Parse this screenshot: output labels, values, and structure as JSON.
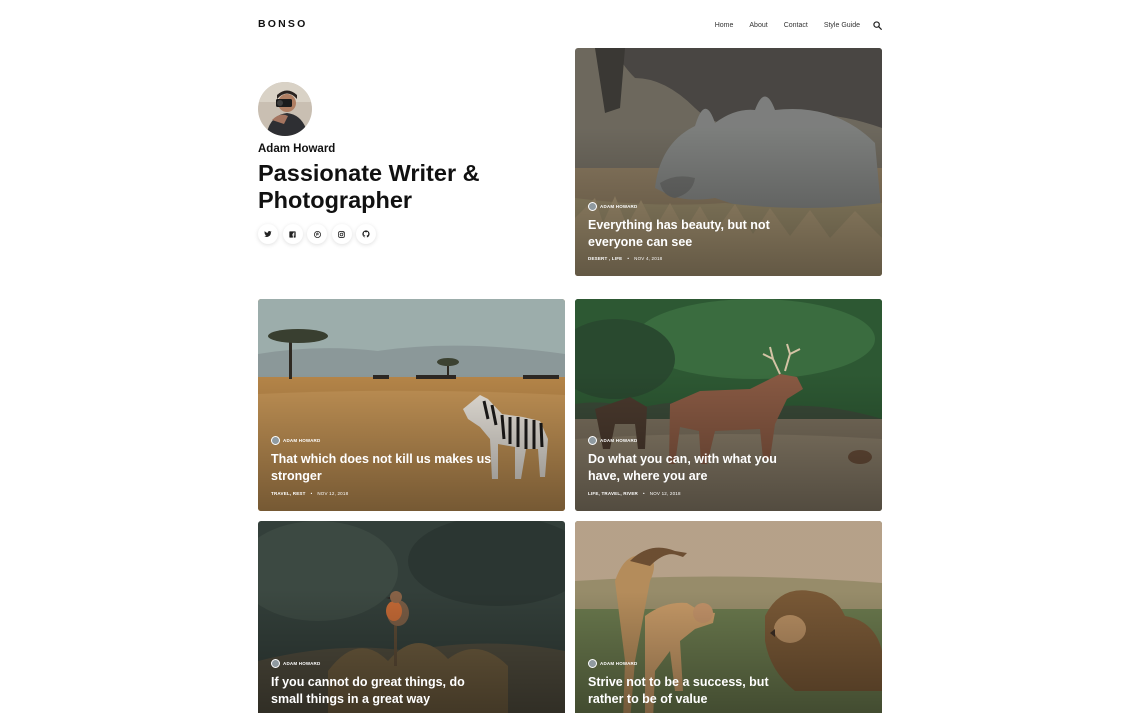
{
  "site": {
    "logo": "BONSO",
    "nav": [
      "Home",
      "About",
      "Contact",
      "Style Guide"
    ]
  },
  "profile": {
    "name": "Adam Howard",
    "headline_line1": "Passionate Writer &",
    "headline_line2": "Photographer",
    "socials": [
      "twitter-icon",
      "facebook-icon",
      "pinterest-icon",
      "instagram-icon",
      "github-icon"
    ]
  },
  "posts": [
    {
      "author": "ADAM HOWARD",
      "title_line1": "Everything has beauty, but not",
      "title_line2": "everyone can see",
      "categories": "DESERT , LIFE",
      "date": "NOV 4, 2018"
    },
    {
      "author": "ADAM HOWARD",
      "title_line1": "That which does not kill us makes us",
      "title_line2": "stronger",
      "categories": "TRAVEL, REST",
      "date": "NOV 12, 2018"
    },
    {
      "author": "ADAM HOWARD",
      "title_line1": "Do what you can, with what you",
      "title_line2": "have, where you are",
      "categories": "LIFE, TRAVEL, RIVER",
      "date": "NOV 12, 2018"
    },
    {
      "author": "ADAM HOWARD",
      "title_line1": "If you cannot do great things, do",
      "title_line2": "small things in a great way"
    },
    {
      "author": "ADAM HOWARD",
      "title_line1": "Strive not to be a success, but",
      "title_line2": "rather to be of value"
    }
  ],
  "colors": {
    "text": "#111111",
    "background": "#ffffff"
  }
}
